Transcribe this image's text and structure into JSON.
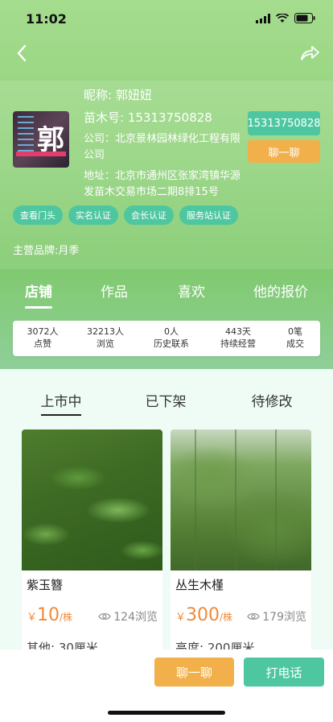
{
  "status_bar": {
    "time": "11:02"
  },
  "profile": {
    "avatar_char": "郭",
    "nickname_label": "昵称:",
    "nickname": "郭妞妞",
    "seedling_no_label": "苗木号:",
    "seedling_no": "15313750828",
    "company": "公司：北京景林园林绿化工程有限公司",
    "address": "地址：北京市通州区张家湾镇华源发苗木交易市场二期8排15号",
    "phone_button": "15313750828",
    "chat_button": "聊一聊",
    "badges": [
      "查看门头",
      "实名认证",
      "会长认证",
      "服务站认证"
    ],
    "brand": "主营品牌:月季"
  },
  "tabs": [
    "店铺",
    "作品",
    "喜欢",
    "他的报价"
  ],
  "stats": [
    {
      "num": "3072人",
      "label": "点赞"
    },
    {
      "num": "32213人",
      "label": "浏览"
    },
    {
      "num": "0人",
      "label": "历史联系"
    },
    {
      "num": "443天",
      "label": "持续经营"
    },
    {
      "num": "0笔",
      "label": "成交"
    }
  ],
  "subtabs": [
    "上市中",
    "已下架",
    "待修改"
  ],
  "products": [
    {
      "title": "紫玉簪",
      "price_symbol": "￥",
      "price": "10",
      "unit": "/株",
      "views": "124浏览",
      "spec": "其他: 30厘米"
    },
    {
      "title": "丛生木槿",
      "price_symbol": "￥",
      "price": "300",
      "unit": "/株",
      "views": "179浏览",
      "spec": "高度: 200厘米"
    }
  ],
  "bottom": {
    "chat": "聊一聊",
    "call": "打电话"
  },
  "colors": {
    "green_header": "#8fd27a",
    "teal_button": "#4ec7a0",
    "orange_button": "#f2b04a",
    "price_orange": "#f08a3a"
  }
}
